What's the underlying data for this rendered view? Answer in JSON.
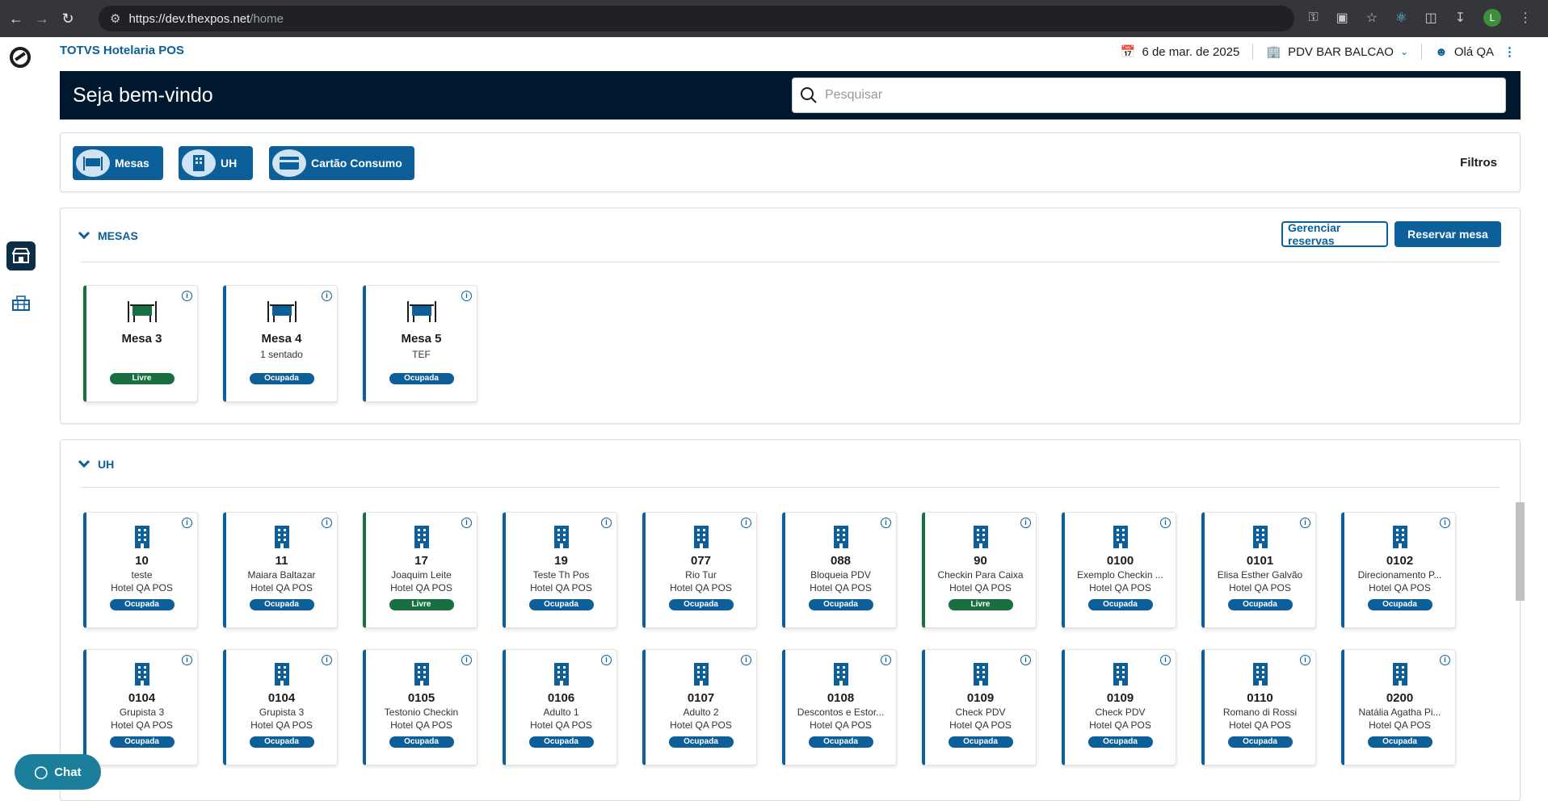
{
  "browser": {
    "url_host": "https://dev.thexpos.net",
    "url_path": "/home",
    "profile_initial": "L"
  },
  "header": {
    "brand": "TOTVS Hotelaria POS",
    "date": "6 de mar. de 2025",
    "pdv": "PDV BAR BALCAO",
    "user": "Olá QA"
  },
  "welcome": {
    "title": "Seja bem-vindo",
    "search_placeholder": "Pesquisar"
  },
  "filters": {
    "mesas": "Mesas",
    "uh": "UH",
    "cartao": "Cartão Consumo",
    "filtros": "Filtros"
  },
  "mesas_section": {
    "title": "MESAS",
    "manage": "Gerenciar reservas",
    "reserve": "Reservar mesa",
    "cards": [
      {
        "name": "Mesa 3",
        "sub": "",
        "status": "Livre"
      },
      {
        "name": "Mesa 4",
        "sub": "1 sentado",
        "status": "Ocupada"
      },
      {
        "name": "Mesa 5",
        "sub": "TEF",
        "status": "Ocupada"
      }
    ]
  },
  "uh_section": {
    "title": "UH",
    "cards": [
      {
        "num": "10",
        "guest": "teste",
        "hotel": "Hotel QA POS",
        "status": "Ocupada"
      },
      {
        "num": "11",
        "guest": "Maiara Baltazar",
        "hotel": "Hotel QA POS",
        "status": "Ocupada"
      },
      {
        "num": "17",
        "guest": "Joaquim Leite",
        "hotel": "Hotel QA POS",
        "status": "Livre"
      },
      {
        "num": "19",
        "guest": "Teste Th Pos",
        "hotel": "Hotel QA POS",
        "status": "Ocupada"
      },
      {
        "num": "077",
        "guest": "Rio Tur",
        "hotel": "Hotel QA POS",
        "status": "Ocupada"
      },
      {
        "num": "088",
        "guest": "Bloqueia PDV",
        "hotel": "Hotel QA POS",
        "status": "Ocupada"
      },
      {
        "num": "90",
        "guest": "Checkin Para Caixa",
        "hotel": "Hotel QA POS",
        "status": "Livre"
      },
      {
        "num": "0100",
        "guest": "Exemplo Checkin ...",
        "hotel": "Hotel QA POS",
        "status": "Ocupada"
      },
      {
        "num": "0101",
        "guest": "Elisa Esther Galvão",
        "hotel": "Hotel QA POS",
        "status": "Ocupada"
      },
      {
        "num": "0102",
        "guest": "Direcionamento P...",
        "hotel": "Hotel QA POS",
        "status": "Ocupada"
      },
      {
        "num": "0104",
        "guest": "Grupista 3",
        "hotel": "Hotel QA POS",
        "status": "Ocupada"
      },
      {
        "num": "0104",
        "guest": "Grupista 3",
        "hotel": "Hotel QA POS",
        "status": "Ocupada"
      },
      {
        "num": "0105",
        "guest": "Testonio Checkin",
        "hotel": "Hotel QA POS",
        "status": "Ocupada"
      },
      {
        "num": "0106",
        "guest": "Adulto 1",
        "hotel": "Hotel QA POS",
        "status": "Ocupada"
      },
      {
        "num": "0107",
        "guest": "Adulto 2",
        "hotel": "Hotel QA POS",
        "status": "Ocupada"
      },
      {
        "num": "0108",
        "guest": "Descontos e Estor...",
        "hotel": "Hotel QA POS",
        "status": "Ocupada"
      },
      {
        "num": "0109",
        "guest": "Check PDV",
        "hotel": "Hotel QA POS",
        "status": "Ocupada"
      },
      {
        "num": "0109",
        "guest": "Check PDV",
        "hotel": "Hotel QA POS",
        "status": "Ocupada"
      },
      {
        "num": "0110",
        "guest": "Romano di Rossi",
        "hotel": "Hotel QA POS",
        "status": "Ocupada"
      },
      {
        "num": "0200",
        "guest": "Natália Agatha Pi...",
        "hotel": "Hotel QA POS",
        "status": "Ocupada"
      }
    ]
  },
  "chat": {
    "label": "Chat"
  },
  "colors": {
    "primary": "#0c5f99",
    "dark": "#00182e",
    "free": "#187040"
  }
}
